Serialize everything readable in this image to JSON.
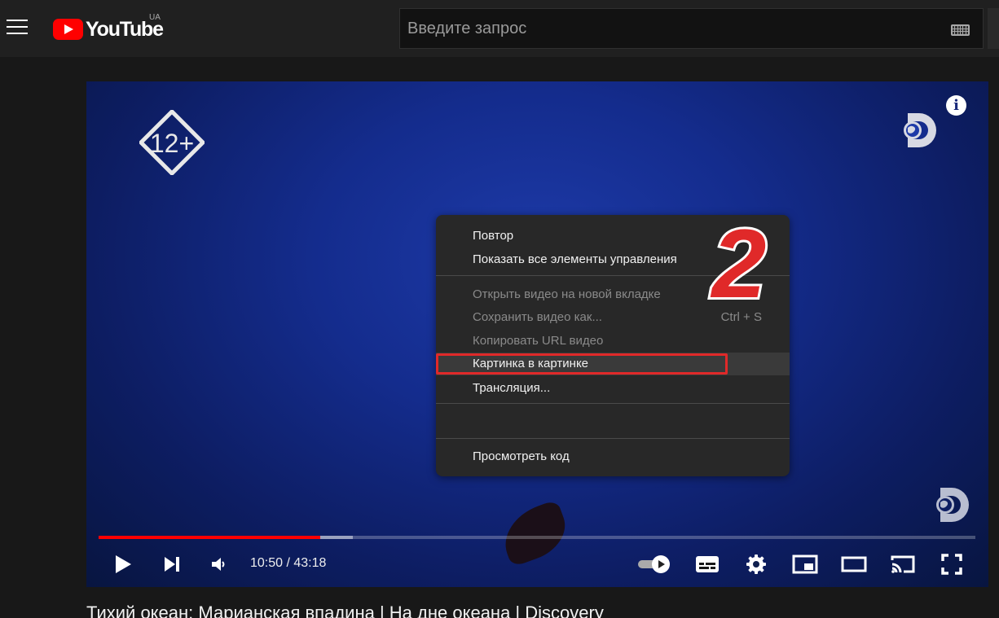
{
  "header": {
    "logo_text": "YouTube",
    "region": "UA",
    "search_placeholder": "Введите запрос"
  },
  "player": {
    "age_rating": "12+",
    "info_symbol": "i",
    "time_display": "10:50 / 43:18",
    "progress_played_fraction": 0.2524,
    "progress_buffered_fraction": 0.29
  },
  "context_menu": {
    "items": [
      {
        "label": "Повтор",
        "disabled": false
      },
      {
        "label": "Показать все элементы управления",
        "disabled": false
      },
      {
        "label": "Открыть видео на новой вкладке",
        "disabled": true
      },
      {
        "label": "Сохранить видео как...",
        "disabled": true,
        "shortcut": "Ctrl + S"
      },
      {
        "label": "Копировать URL видео",
        "disabled": true
      },
      {
        "label": "Картинка в картинке",
        "disabled": false,
        "highlighted": true
      },
      {
        "label": "Трансляция...",
        "disabled": false
      },
      {
        "label": "Просмотреть код",
        "disabled": false
      }
    ]
  },
  "annotation": {
    "step_number": "2",
    "color": "#e02929"
  },
  "video_title": "Тихий океан: Марианская впадина | На дне океана | Discovery",
  "colors": {
    "accent": "#ff0000",
    "background": "#181818",
    "topbar": "#202020",
    "menu": "#282828"
  }
}
